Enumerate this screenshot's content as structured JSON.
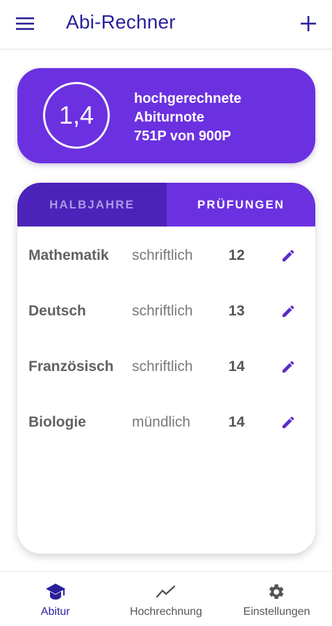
{
  "app": {
    "title": "Abi-Rechner",
    "accent": "#6b31e0",
    "accent_dark": "#4c23b8",
    "title_color": "#2a1f9a"
  },
  "summary": {
    "grade": "1,4",
    "line1": "hochgerechnete",
    "line2": "Abiturnote",
    "line3": "751P von 900P"
  },
  "tabs": [
    {
      "label": "HALBJAHRE",
      "selected": false
    },
    {
      "label": "PRÜFUNGEN",
      "selected": true
    }
  ],
  "exams": [
    {
      "subject": "Mathematik",
      "type": "schriftlich",
      "points": "12"
    },
    {
      "subject": "Deutsch",
      "type": "schriftlich",
      "points": "13"
    },
    {
      "subject": "Französisch",
      "type": "schriftlich",
      "points": "14"
    },
    {
      "subject": "Biologie",
      "type": "mündlich",
      "points": "14"
    }
  ],
  "bottom_nav": [
    {
      "label": "Abitur",
      "icon": "graduation-cap-icon",
      "active": true
    },
    {
      "label": "Hochrechnung",
      "icon": "trending-up-icon",
      "active": false
    },
    {
      "label": "Einstellungen",
      "icon": "gear-icon",
      "active": false
    }
  ]
}
